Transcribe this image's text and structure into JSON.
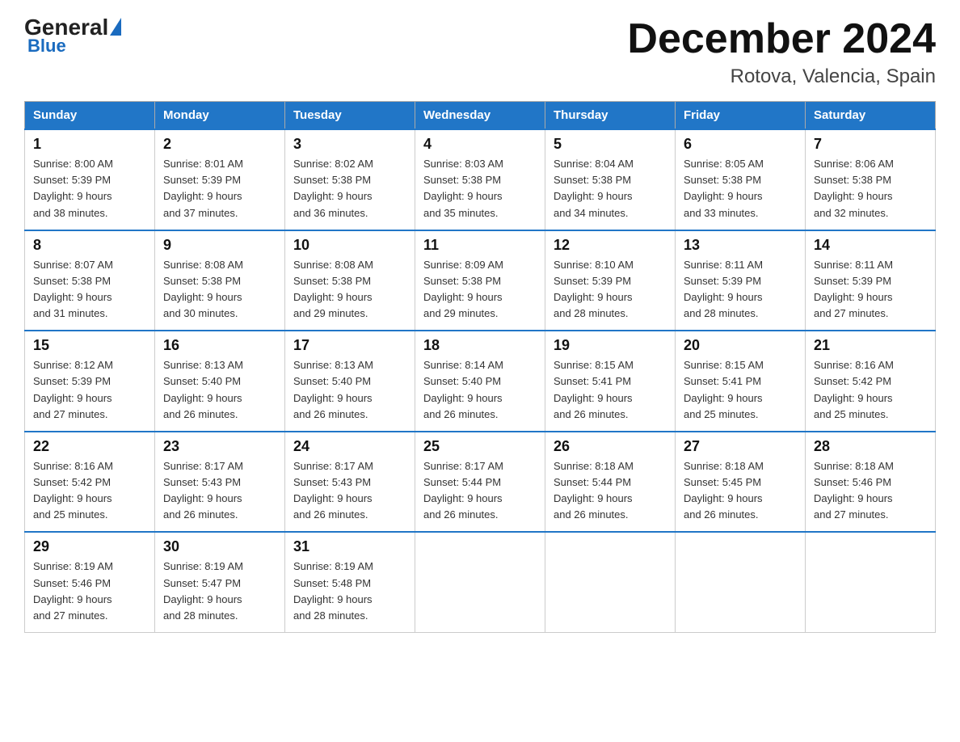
{
  "logo": {
    "general": "General",
    "blue": "Blue"
  },
  "header": {
    "title": "December 2024",
    "subtitle": "Rotova, Valencia, Spain"
  },
  "days_of_week": [
    "Sunday",
    "Monday",
    "Tuesday",
    "Wednesday",
    "Thursday",
    "Friday",
    "Saturday"
  ],
  "weeks": [
    [
      {
        "day": "1",
        "sunrise": "8:00 AM",
        "sunset": "5:39 PM",
        "daylight": "9 hours and 38 minutes."
      },
      {
        "day": "2",
        "sunrise": "8:01 AM",
        "sunset": "5:39 PM",
        "daylight": "9 hours and 37 minutes."
      },
      {
        "day": "3",
        "sunrise": "8:02 AM",
        "sunset": "5:38 PM",
        "daylight": "9 hours and 36 minutes."
      },
      {
        "day": "4",
        "sunrise": "8:03 AM",
        "sunset": "5:38 PM",
        "daylight": "9 hours and 35 minutes."
      },
      {
        "day": "5",
        "sunrise": "8:04 AM",
        "sunset": "5:38 PM",
        "daylight": "9 hours and 34 minutes."
      },
      {
        "day": "6",
        "sunrise": "8:05 AM",
        "sunset": "5:38 PM",
        "daylight": "9 hours and 33 minutes."
      },
      {
        "day": "7",
        "sunrise": "8:06 AM",
        "sunset": "5:38 PM",
        "daylight": "9 hours and 32 minutes."
      }
    ],
    [
      {
        "day": "8",
        "sunrise": "8:07 AM",
        "sunset": "5:38 PM",
        "daylight": "9 hours and 31 minutes."
      },
      {
        "day": "9",
        "sunrise": "8:08 AM",
        "sunset": "5:38 PM",
        "daylight": "9 hours and 30 minutes."
      },
      {
        "day": "10",
        "sunrise": "8:08 AM",
        "sunset": "5:38 PM",
        "daylight": "9 hours and 29 minutes."
      },
      {
        "day": "11",
        "sunrise": "8:09 AM",
        "sunset": "5:38 PM",
        "daylight": "9 hours and 29 minutes."
      },
      {
        "day": "12",
        "sunrise": "8:10 AM",
        "sunset": "5:39 PM",
        "daylight": "9 hours and 28 minutes."
      },
      {
        "day": "13",
        "sunrise": "8:11 AM",
        "sunset": "5:39 PM",
        "daylight": "9 hours and 28 minutes."
      },
      {
        "day": "14",
        "sunrise": "8:11 AM",
        "sunset": "5:39 PM",
        "daylight": "9 hours and 27 minutes."
      }
    ],
    [
      {
        "day": "15",
        "sunrise": "8:12 AM",
        "sunset": "5:39 PM",
        "daylight": "9 hours and 27 minutes."
      },
      {
        "day": "16",
        "sunrise": "8:13 AM",
        "sunset": "5:40 PM",
        "daylight": "9 hours and 26 minutes."
      },
      {
        "day": "17",
        "sunrise": "8:13 AM",
        "sunset": "5:40 PM",
        "daylight": "9 hours and 26 minutes."
      },
      {
        "day": "18",
        "sunrise": "8:14 AM",
        "sunset": "5:40 PM",
        "daylight": "9 hours and 26 minutes."
      },
      {
        "day": "19",
        "sunrise": "8:15 AM",
        "sunset": "5:41 PM",
        "daylight": "9 hours and 26 minutes."
      },
      {
        "day": "20",
        "sunrise": "8:15 AM",
        "sunset": "5:41 PM",
        "daylight": "9 hours and 25 minutes."
      },
      {
        "day": "21",
        "sunrise": "8:16 AM",
        "sunset": "5:42 PM",
        "daylight": "9 hours and 25 minutes."
      }
    ],
    [
      {
        "day": "22",
        "sunrise": "8:16 AM",
        "sunset": "5:42 PM",
        "daylight": "9 hours and 25 minutes."
      },
      {
        "day": "23",
        "sunrise": "8:17 AM",
        "sunset": "5:43 PM",
        "daylight": "9 hours and 26 minutes."
      },
      {
        "day": "24",
        "sunrise": "8:17 AM",
        "sunset": "5:43 PM",
        "daylight": "9 hours and 26 minutes."
      },
      {
        "day": "25",
        "sunrise": "8:17 AM",
        "sunset": "5:44 PM",
        "daylight": "9 hours and 26 minutes."
      },
      {
        "day": "26",
        "sunrise": "8:18 AM",
        "sunset": "5:44 PM",
        "daylight": "9 hours and 26 minutes."
      },
      {
        "day": "27",
        "sunrise": "8:18 AM",
        "sunset": "5:45 PM",
        "daylight": "9 hours and 26 minutes."
      },
      {
        "day": "28",
        "sunrise": "8:18 AM",
        "sunset": "5:46 PM",
        "daylight": "9 hours and 27 minutes."
      }
    ],
    [
      {
        "day": "29",
        "sunrise": "8:19 AM",
        "sunset": "5:46 PM",
        "daylight": "9 hours and 27 minutes."
      },
      {
        "day": "30",
        "sunrise": "8:19 AM",
        "sunset": "5:47 PM",
        "daylight": "9 hours and 28 minutes."
      },
      {
        "day": "31",
        "sunrise": "8:19 AM",
        "sunset": "5:48 PM",
        "daylight": "9 hours and 28 minutes."
      },
      null,
      null,
      null,
      null
    ]
  ],
  "labels": {
    "sunrise": "Sunrise:",
    "sunset": "Sunset:",
    "daylight": "Daylight:"
  }
}
